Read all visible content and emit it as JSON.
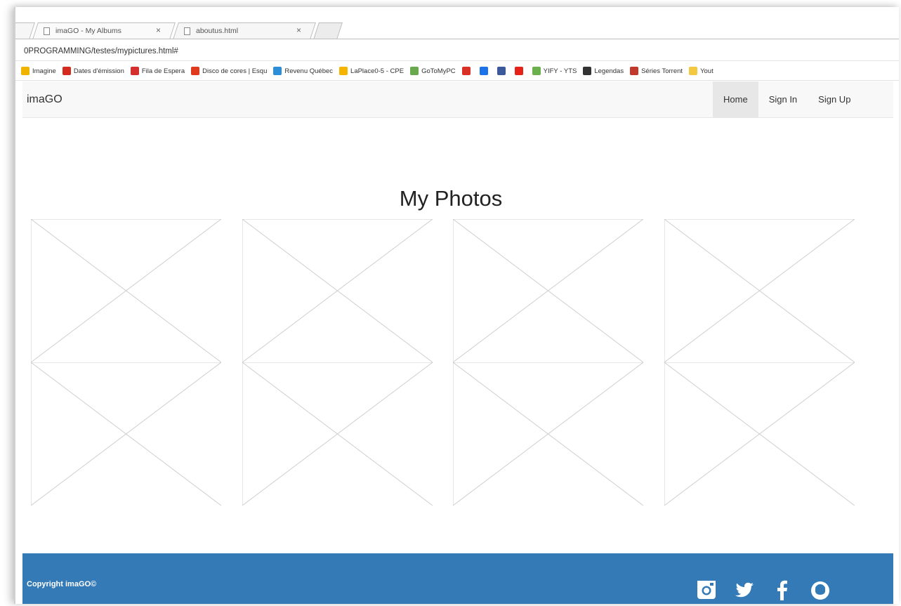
{
  "browser": {
    "tabs": [
      {
        "label": "imaGO - My Albums",
        "close": "×"
      },
      {
        "label": "aboutus.html",
        "close": "×"
      }
    ],
    "address": "0PROGRAMMING/testes/mypictures.html#",
    "bookmarks": [
      {
        "label": "Imagine",
        "icon": "bookmark-flag-icon",
        "color": "#f0b400"
      },
      {
        "label": "Dates d'émission",
        "icon": "maple-leaf-icon",
        "color": "#d52b1e"
      },
      {
        "label": "Fila de Espera",
        "icon": "pin-icon",
        "color": "#d32f2f"
      },
      {
        "label": "Disco de cores | Esqu",
        "icon": "adobe-icon",
        "color": "#e03a1e"
      },
      {
        "label": "Revenu Québec",
        "icon": "rq-icon",
        "color": "#2a8fd8"
      },
      {
        "label": "LaPlace0-5 - CPE",
        "icon": "sun-icon",
        "color": "#f4b400"
      },
      {
        "label": "GoToMyPC",
        "icon": "gotomypc-icon",
        "color": "#6aa84f"
      },
      {
        "label": "",
        "icon": "gmail-icon",
        "color": "#d93025"
      },
      {
        "label": "",
        "icon": "drive-icon",
        "color": "#1a73e8"
      },
      {
        "label": "",
        "icon": "facebook-icon",
        "color": "#3b5998"
      },
      {
        "label": "",
        "icon": "youtube-icon",
        "color": "#e62117"
      },
      {
        "label": "YIFY - YTS",
        "icon": "yify-icon",
        "color": "#6ab04c"
      },
      {
        "label": "Legendas",
        "icon": "opensubtitles-icon",
        "color": "#333333"
      },
      {
        "label": "Séries Torrent",
        "icon": "popcorn-icon",
        "color": "#c0392b"
      },
      {
        "label": "Yout",
        "icon": "folder-icon",
        "color": "#f5c842"
      }
    ]
  },
  "navbar": {
    "brand": "imaGO",
    "links": [
      {
        "label": "Home",
        "active": true
      },
      {
        "label": "Sign In",
        "active": false
      },
      {
        "label": "Sign Up",
        "active": false
      }
    ]
  },
  "main": {
    "title": "My Photos",
    "photo_count": 8
  },
  "footer": {
    "copyright": "Copyright imaGO©",
    "social_icons": [
      "instagram-icon",
      "twitter-icon",
      "facebook-icon",
      "github-icon"
    ]
  },
  "colors": {
    "footer_bg": "#337ab7",
    "navbar_bg": "#f8f8f8",
    "active_link_bg": "#e7e7e7",
    "placeholder_line": "#cfcfcf"
  }
}
